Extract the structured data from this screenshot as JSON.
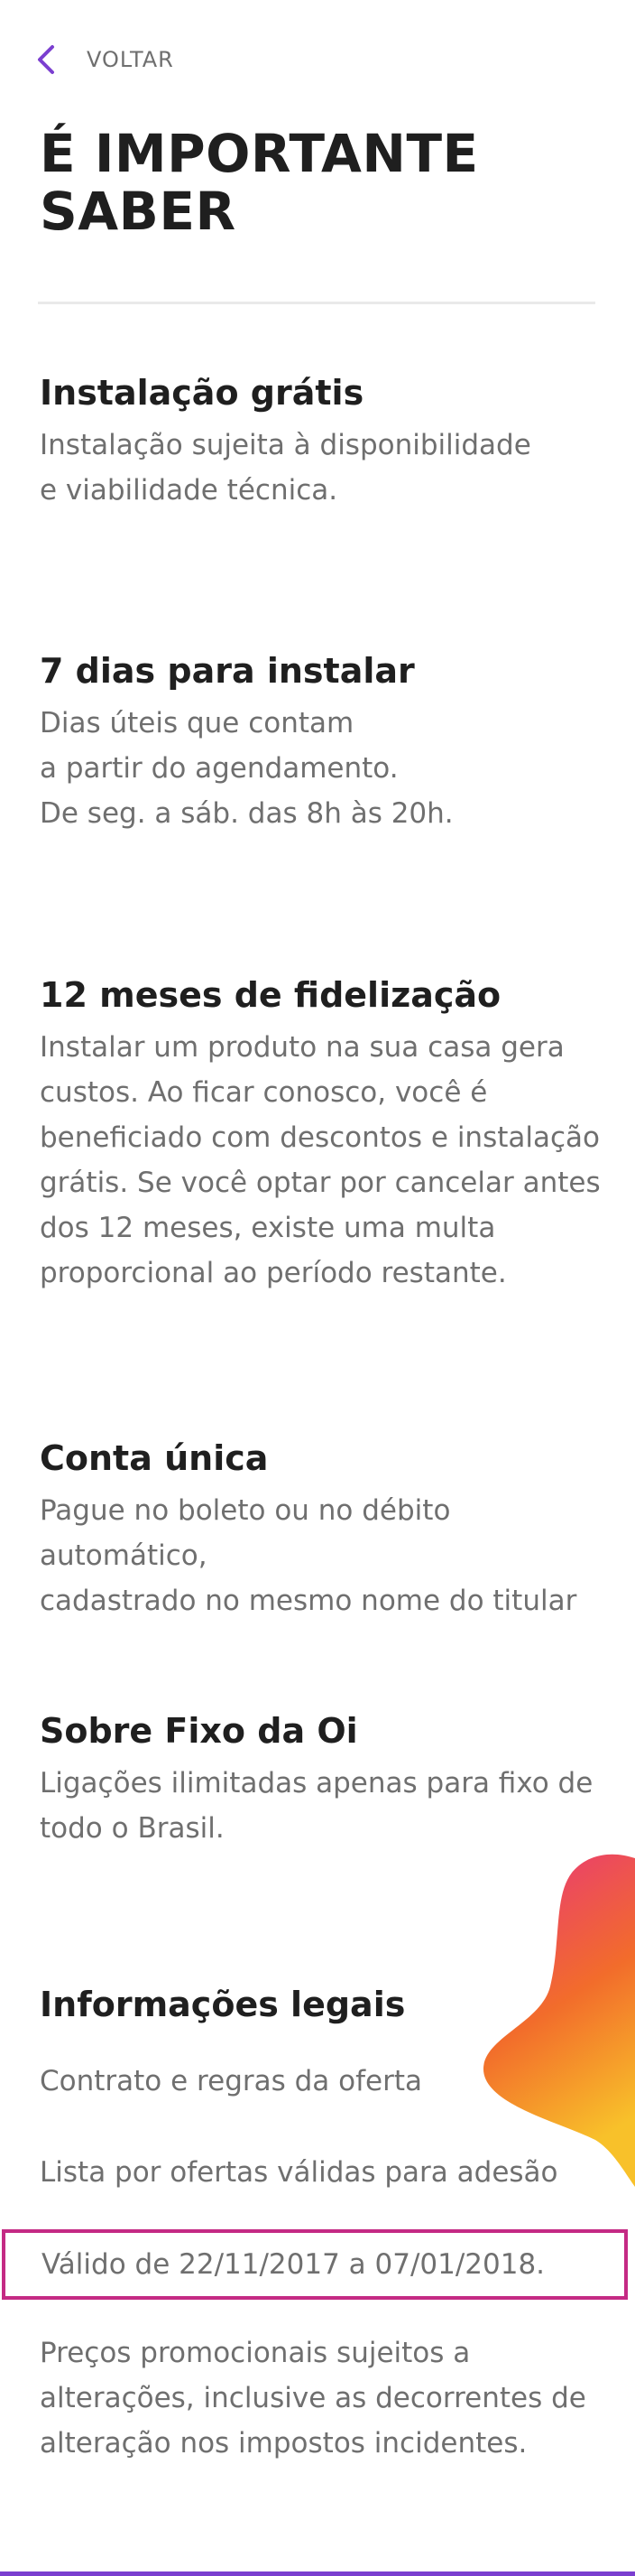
{
  "header": {
    "back_label": "VOLTAR",
    "title": "É IMPORTANTE\nSABER"
  },
  "colors": {
    "accent_purple": "#7b3fd0",
    "highlight_magenta": "#c42a84",
    "blob_gradient": [
      "#e8337f",
      "#f26c2b",
      "#f8c12a"
    ]
  },
  "sections": [
    {
      "title": "Instalação grátis",
      "body": "Instalação sujeita à disponibilidade\ne viabilidade técnica."
    },
    {
      "title": "7 dias para instalar",
      "body": "Dias úteis que contam\na partir do agendamento.\nDe seg. a sáb. das 8h às 20h."
    },
    {
      "title": "12 meses de fidelização",
      "body": "Instalar um produto na sua casa gera\ncustos. Ao ficar conosco, você é\nbeneficiado com descontos e instalação\ngrátis. Se você optar por cancelar antes\ndos 12 meses, existe uma multa\nproporcional ao período restante."
    },
    {
      "title": "Conta única",
      "body": "Pague no boleto ou no débito automático,\ncadastrado no mesmo nome do titular"
    },
    {
      "title": "Sobre Fixo da Oi",
      "body": "Ligações ilimitadas apenas para fixo de\ntodo o Brasil."
    },
    {
      "title": "Informações legais"
    }
  ],
  "legal": {
    "contract_link": "Contrato e regras da oferta",
    "offers_list_link": "Lista por ofertas válidas para adesão",
    "validity": "Válido de 22/11/2017 a 07/01/2018.",
    "promo_note": "Preços promocionais sujeitos a\nalterações, inclusive as decorrentes de\nalteração nos impostos incidentes."
  }
}
